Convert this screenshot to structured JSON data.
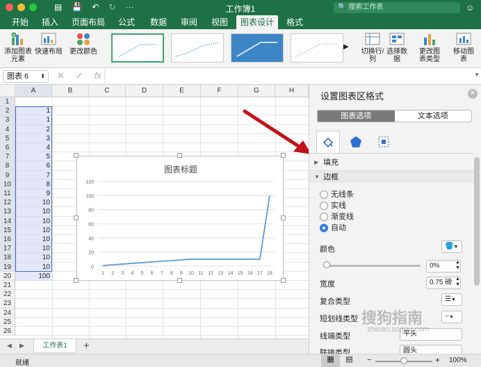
{
  "window": {
    "title": "工作簿1",
    "search_placeholder": "搜索工作表"
  },
  "tabs": [
    "开始",
    "插入",
    "页面布局",
    "公式",
    "数据",
    "审阅",
    "视图",
    "图表设计",
    "格式"
  ],
  "active_tab": "图表设计",
  "ribbon": {
    "add_element": "添加图表元素",
    "quick_layout": "快速布局",
    "change_color": "更改颜色",
    "switch_row_col": "切换行/列",
    "select_data": "选择数据",
    "change_type": "更改图表类型",
    "move_chart": "移动图表"
  },
  "formula_bar": {
    "name_box": "图表 6",
    "fx": "fx"
  },
  "columns": [
    "A",
    "B",
    "C",
    "D",
    "E",
    "F",
    "G",
    "H"
  ],
  "column_a_values": [
    "1",
    "1",
    "2",
    "3",
    "4",
    "5",
    "6",
    "7",
    "8",
    "9",
    "10",
    "10",
    "10",
    "10",
    "10",
    "10",
    "10",
    "10",
    "100"
  ],
  "chart_data": {
    "type": "line",
    "title": "图表标题",
    "categories": [
      "1",
      "2",
      "3",
      "4",
      "5",
      "6",
      "7",
      "8",
      "9",
      "10",
      "11",
      "12",
      "13",
      "14",
      "15",
      "16",
      "17",
      "18"
    ],
    "series": [
      {
        "values": [
          1,
          2,
          3,
          4,
          5,
          6,
          7,
          8,
          9,
          10,
          10,
          10,
          10,
          10,
          10,
          10,
          10,
          100
        ]
      }
    ],
    "ylim": [
      0,
      120
    ],
    "yticks": [
      0,
      20,
      40,
      60,
      80,
      100,
      120
    ],
    "grid": true,
    "color": "#5b9bd5"
  },
  "sheet": {
    "tab_name": "工作表1",
    "add_label": "+"
  },
  "status": {
    "text": "就绪",
    "zoom": "100%"
  },
  "panel": {
    "title": "设置图表区格式",
    "seg_chart": "图表选项",
    "seg_text": "文本选项",
    "fill_label": "填充",
    "border_label": "边框",
    "radio_none": "无线条",
    "radio_solid": "实线",
    "radio_gradient": "渐变线",
    "radio_auto": "自动",
    "color_label": "颜色",
    "transparency": "0%",
    "width_label": "宽度",
    "width_value": "0.75 磅",
    "compound_label": "复合类型",
    "dash_label": "短划线类型",
    "cap_label": "线端类型",
    "cap_value": "平头",
    "join_label": "联接类型",
    "join_value": "圆头"
  },
  "watermark": {
    "main": "搜狗指南",
    "url": "zhinan.sogou.com"
  }
}
